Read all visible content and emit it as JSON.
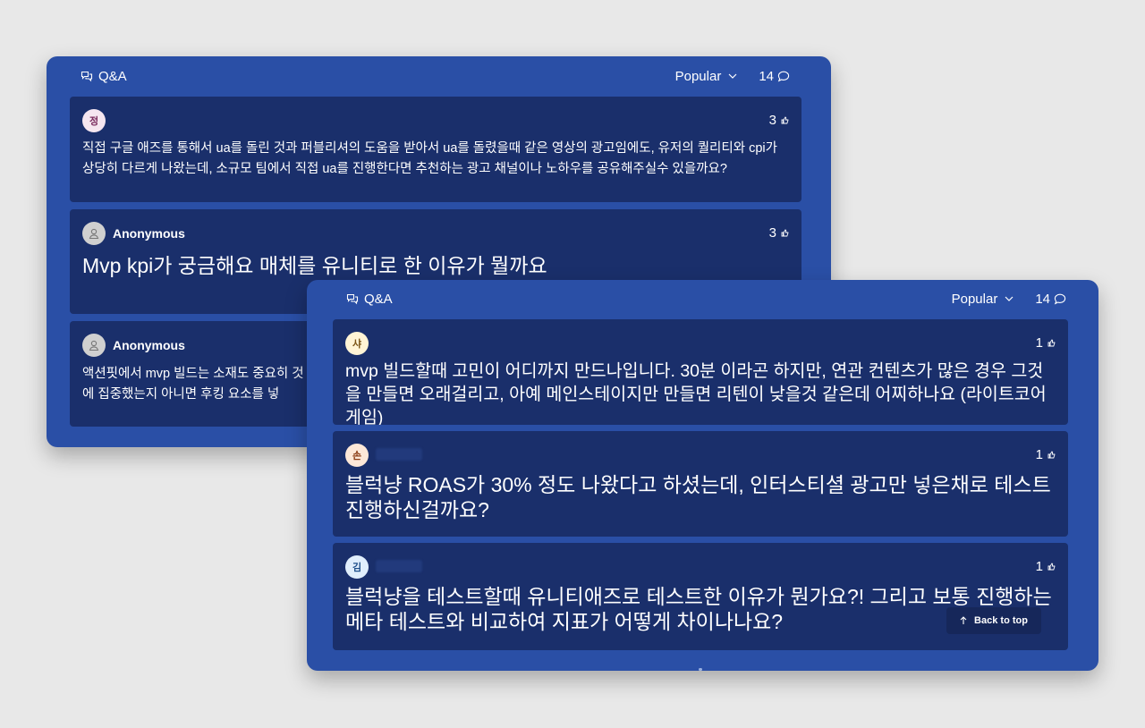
{
  "back_panel": {
    "title": "Q&A",
    "sort_label": "Popular",
    "count": "14",
    "posts": [
      {
        "avatar": "정",
        "author": "",
        "likes": "3",
        "text": "직접 구글 애즈를 통해서 ua를 돌린 것과 퍼블리셔의 도움을 받아서 ua를 돌렸을때 같은 영상의 광고임에도, 유저의 퀄리티와 cpi가 상당히 다르게 나왔는데, 소규모 팀에서 직접 ua를 진행한다면 추천하는 광고 채널이나 노하우를 공유해주실수 있을까요?"
      },
      {
        "avatar": "",
        "author": "Anonymous",
        "likes": "3",
        "text": "Mvp kpi가 궁금해요 매체를 유니티로 한 이유가 뭘까요"
      },
      {
        "avatar": "",
        "author": "Anonymous",
        "likes": "",
        "text": "액션핏에서 mvp 빌드는 소재도 중요히 것에 집중했는지 아니면 후킹 요소를 넣"
      }
    ]
  },
  "front_panel": {
    "title": "Q&A",
    "sort_label": "Popular",
    "count": "14",
    "posts": [
      {
        "avatar": "샤",
        "likes": "1",
        "text": "mvp 빌드할때 고민이 어디까지 만드나입니다. 30분 이라곤 하지만, 연관 컨텐츠가 많은 경우 그것을 만들면 오래걸리고, 아예 메인스테이지만 만들면 리텐이 낮을것 같은데 어찌하나요 (라이트코어 게임)"
      },
      {
        "avatar": "손",
        "likes": "1",
        "text": "블럭냥 ROAS가 30% 정도 나왔다고 하셨는데, 인터스티셜 광고만 넣은채로 테스트 진행하신걸까요?"
      },
      {
        "avatar": "김",
        "likes": "1",
        "text": "블럭냥을 테스트할때 유니티애즈로 테스트한 이유가 뭔가요?! 그리고 보통 진행하는 메타 테스트와 비교하여 지표가 어떻게 차이나나요?"
      }
    ],
    "back_to_top": "Back to top"
  },
  "icons": {
    "chat": "chat-bubbles-icon",
    "chevron": "chevron-down-icon",
    "comment": "comment-bubble-icon",
    "like": "thumbs-up-icon",
    "user": "user-silhouette-icon",
    "arrow_up": "arrow-up-icon"
  },
  "colors": {
    "page_bg": "#e8e8e8",
    "panel_bg": "#2a4fa6",
    "card_bg": "#1a2f6b"
  }
}
